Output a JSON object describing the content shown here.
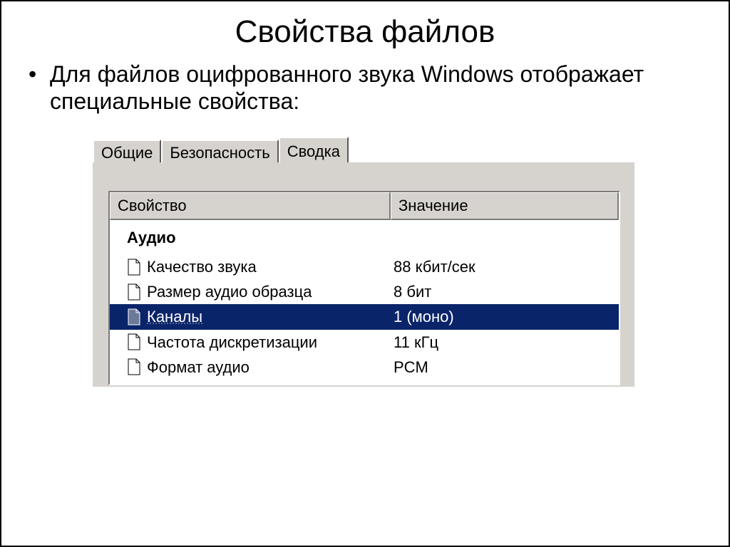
{
  "slide": {
    "title": "Свойства файлов",
    "bullet": "Для файлов оцифрованного звука Windows отображает специальные свойства:"
  },
  "dialog": {
    "tabs": [
      {
        "label": "Общие",
        "active": false
      },
      {
        "label": "Безопасность",
        "active": false
      },
      {
        "label": "Сводка",
        "active": true
      }
    ],
    "columns": {
      "property": "Свойство",
      "value": "Значение"
    },
    "group": "Аудио",
    "rows": [
      {
        "prop": "Качество звука",
        "val": "88 кбит/сек",
        "selected": false
      },
      {
        "prop": "Размер аудио образца",
        "val": "8 бит",
        "selected": false
      },
      {
        "prop": "Каналы",
        "val": "1 (моно)",
        "selected": true
      },
      {
        "prop": "Частота дискретизации",
        "val": "11 кГц",
        "selected": false
      },
      {
        "prop": "Формат аудио",
        "val": "PCM",
        "selected": false
      }
    ]
  }
}
